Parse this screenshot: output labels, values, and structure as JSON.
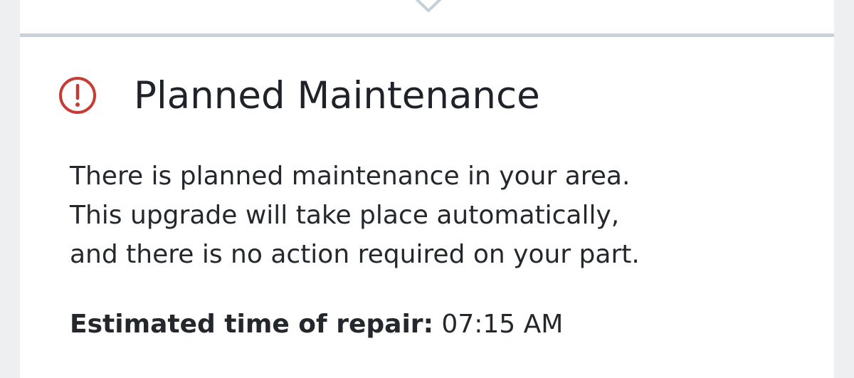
{
  "colors": {
    "background": "#edeff1",
    "card": "#ffffff",
    "divider": "#c9d2da",
    "alert_icon": "#c73b35",
    "text": "#24282d"
  },
  "icons": {
    "expand_chevron": "chevron-down-icon",
    "alert": "exclamation-circle-icon"
  },
  "notice": {
    "title": "Planned Maintenance",
    "body_lines": [
      "There is planned maintenance in your area.",
      "This upgrade will take place automatically,",
      "and there is no action required on your part."
    ],
    "repair_label": "Estimated time of repair:",
    "repair_time": "07:15 AM"
  }
}
